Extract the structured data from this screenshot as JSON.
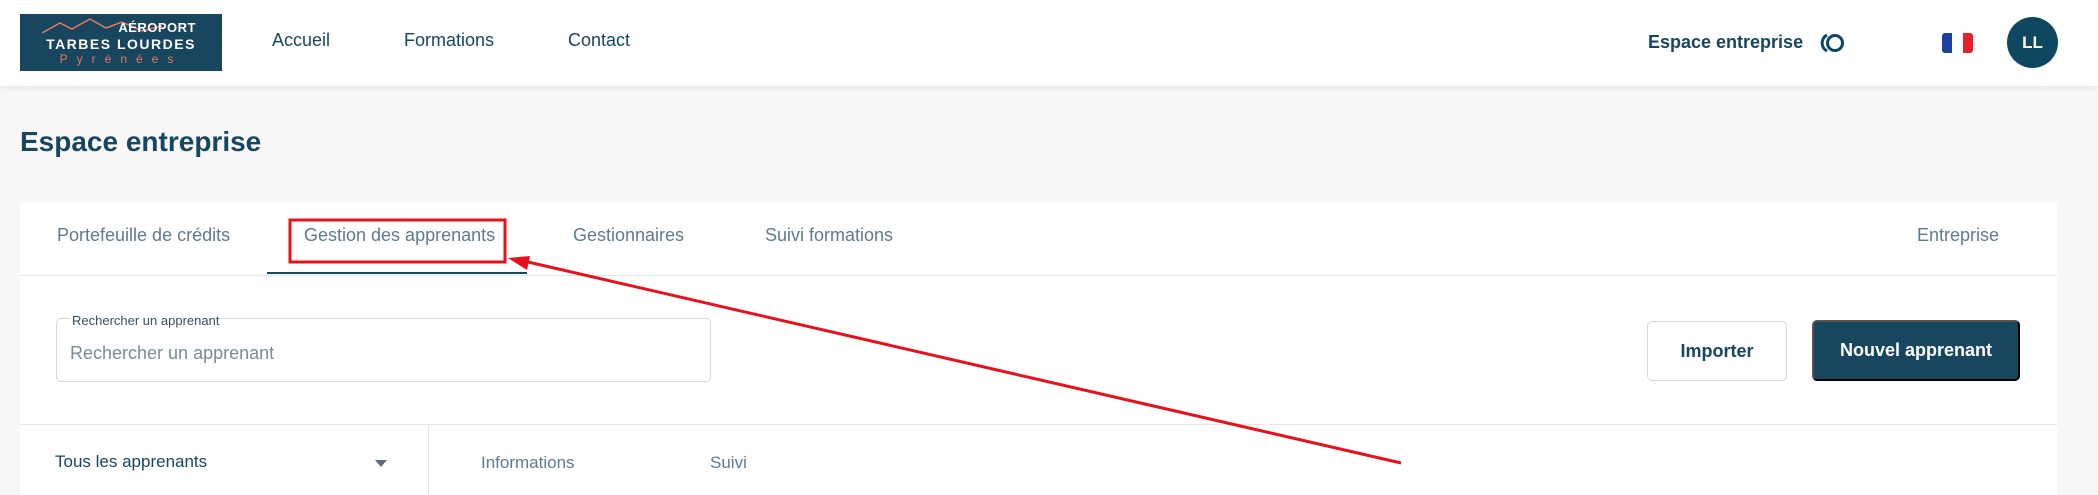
{
  "header": {
    "logo": {
      "line1": "AÉROPORT",
      "line2": "TARBES LOURDES",
      "line3": "Pyrénées"
    },
    "nav": [
      {
        "label": "Accueil"
      },
      {
        "label": "Formations"
      },
      {
        "label": "Contact"
      }
    ],
    "espace_label": "Espace entreprise",
    "avatar_initials": "LL",
    "language_flag": "fr-flag-icon",
    "colors": {
      "brand": "#17465e",
      "accent": "#e07a5f"
    }
  },
  "page": {
    "title": "Espace entreprise"
  },
  "tabs": [
    {
      "label": "Portefeuille de crédits"
    },
    {
      "label": "Gestion des apprenants",
      "active": true
    },
    {
      "label": "Gestionnaires"
    },
    {
      "label": "Suivi formations"
    },
    {
      "label": "Entreprise"
    }
  ],
  "search": {
    "label": "Rechercher un apprenant",
    "placeholder": "Rechercher un apprenant"
  },
  "actions": {
    "import_label": "Importer",
    "new_label": "Nouvel apprenant"
  },
  "filter": {
    "selected": "Tous les apprenants"
  },
  "subtabs": [
    {
      "label": "Informations"
    },
    {
      "label": "Suivi"
    }
  ],
  "annotation": {
    "color": "#e8101a"
  }
}
